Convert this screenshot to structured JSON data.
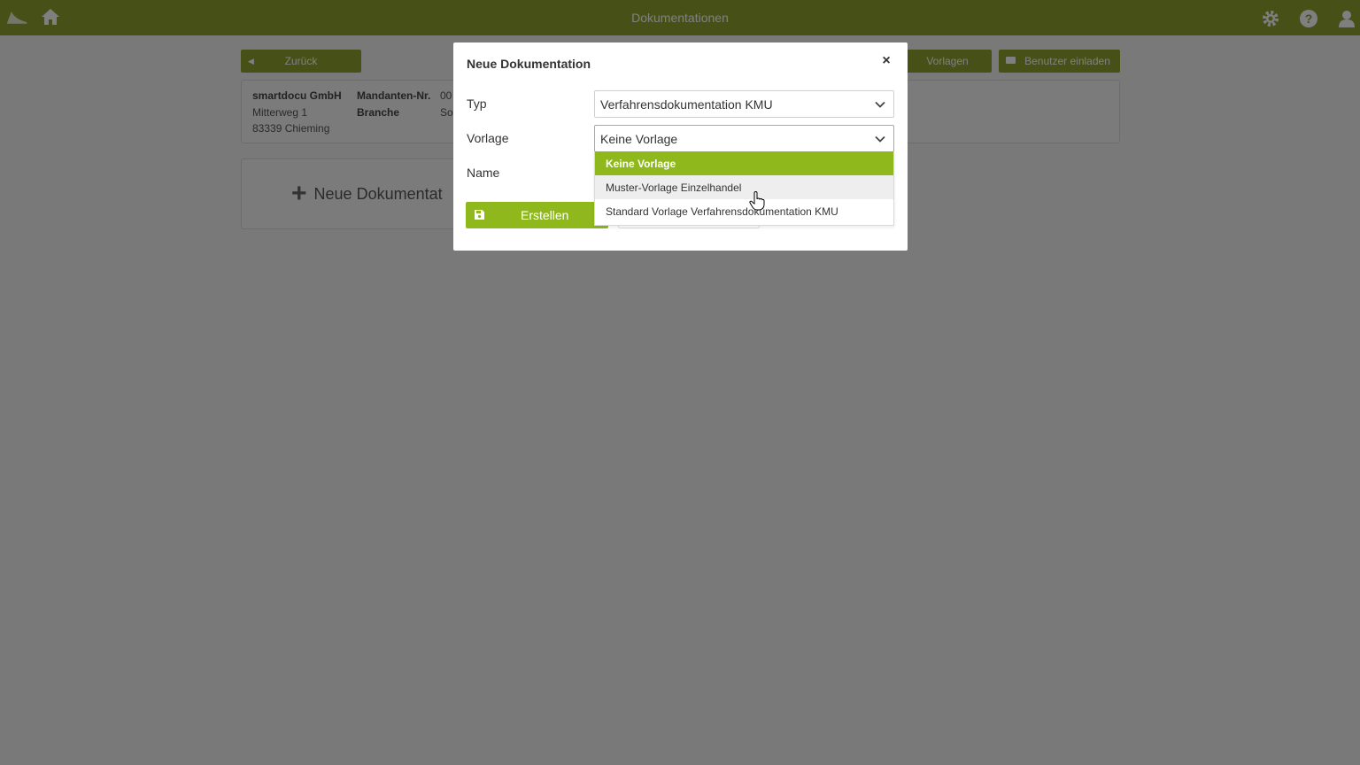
{
  "app": {
    "title": "Dokumentationen"
  },
  "topbar": {
    "icons": [
      "logo-icon",
      "home-icon",
      "gear-icon",
      "help-icon",
      "user-icon"
    ]
  },
  "toolbar": {
    "back_label": "Zurück",
    "templates_label": "Vorlagen",
    "invite_label": "Benutzer einladen"
  },
  "client": {
    "name": "smartdocu GmbH",
    "street": "Mitterweg 1",
    "city": "83339 Chieming",
    "client_no_label": "Mandanten-Nr.",
    "client_no_value": "00",
    "industry_label": "Branche",
    "industry_value": "So"
  },
  "new_doc_card": {
    "label": "Neue Dokumentat"
  },
  "modal": {
    "title": "Neue Dokumentation",
    "close": "×",
    "type_label": "Typ",
    "type_value": "Verfahrensdokumentation KMU",
    "template_label": "Vorlage",
    "template_value": "Keine Vorlage",
    "name_label": "Name",
    "create_label": "Erstellen",
    "template_options": [
      "Keine Vorlage",
      "Muster-Vorlage Einzelhandel",
      "Standard Vorlage Verfahrensdokumentation KMU"
    ]
  },
  "colors": {
    "brand_green": "#8fa22e",
    "accent_green": "#8fb81c",
    "overlay": "rgba(0,0,0,0.5)"
  }
}
